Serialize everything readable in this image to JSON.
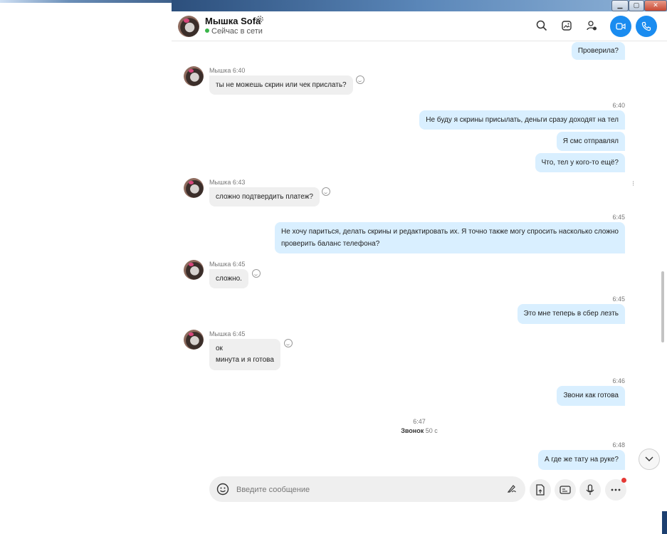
{
  "window": {
    "min_label": "▁",
    "max_label": "▢",
    "close_label": "✕"
  },
  "header": {
    "name": "Мышка Sofa",
    "status": "Сейчас в сети",
    "icons": [
      "search-icon",
      "gallery-icon",
      "add-person-icon",
      "video-call-icon",
      "audio-call-icon"
    ],
    "accent": "#1a8cf0"
  },
  "messages": [
    {
      "dir": "out",
      "text": "Проверила?"
    },
    {
      "dir": "in",
      "sender": "Мышка",
      "time": "6:40",
      "lines": [
        "ты не можешь скрин или чек прислать?"
      ]
    },
    {
      "dir": "out",
      "time": "6:40",
      "text": "Не буду я скрины присылать, деньги сразу доходят на тел"
    },
    {
      "dir": "out",
      "text": "Я смс отправлял"
    },
    {
      "dir": "out",
      "text": "Что, тел у кого-то ещё?"
    },
    {
      "dir": "in",
      "sender": "Мышка",
      "time": "6:43",
      "lines": [
        "сложно подтвердить платеж?"
      ]
    },
    {
      "dir": "out",
      "time": "6:45",
      "lines": [
        "Не хочу париться, делать скрины и редактировать их. Я точно также могу спросить насколько сложно",
        "проверить баланс телефона?"
      ]
    },
    {
      "dir": "in",
      "sender": "Мышка",
      "time": "6:45",
      "lines": [
        "сложно."
      ]
    },
    {
      "dir": "out",
      "time": "6:45",
      "text": "Это мне теперь в сбер лезть"
    },
    {
      "dir": "in",
      "sender": "Мышка",
      "time": "6:45",
      "lines": [
        "ок",
        "минута и я готова"
      ]
    },
    {
      "dir": "out",
      "time": "6:46",
      "text": "Звони как готова"
    },
    {
      "dir": "call",
      "time": "6:47",
      "label": "Звонок",
      "duration": "50 с"
    },
    {
      "dir": "out",
      "time": "6:48",
      "text": "А где же тату на руке?"
    }
  ],
  "composer": {
    "placeholder": "Введите сообщение"
  }
}
